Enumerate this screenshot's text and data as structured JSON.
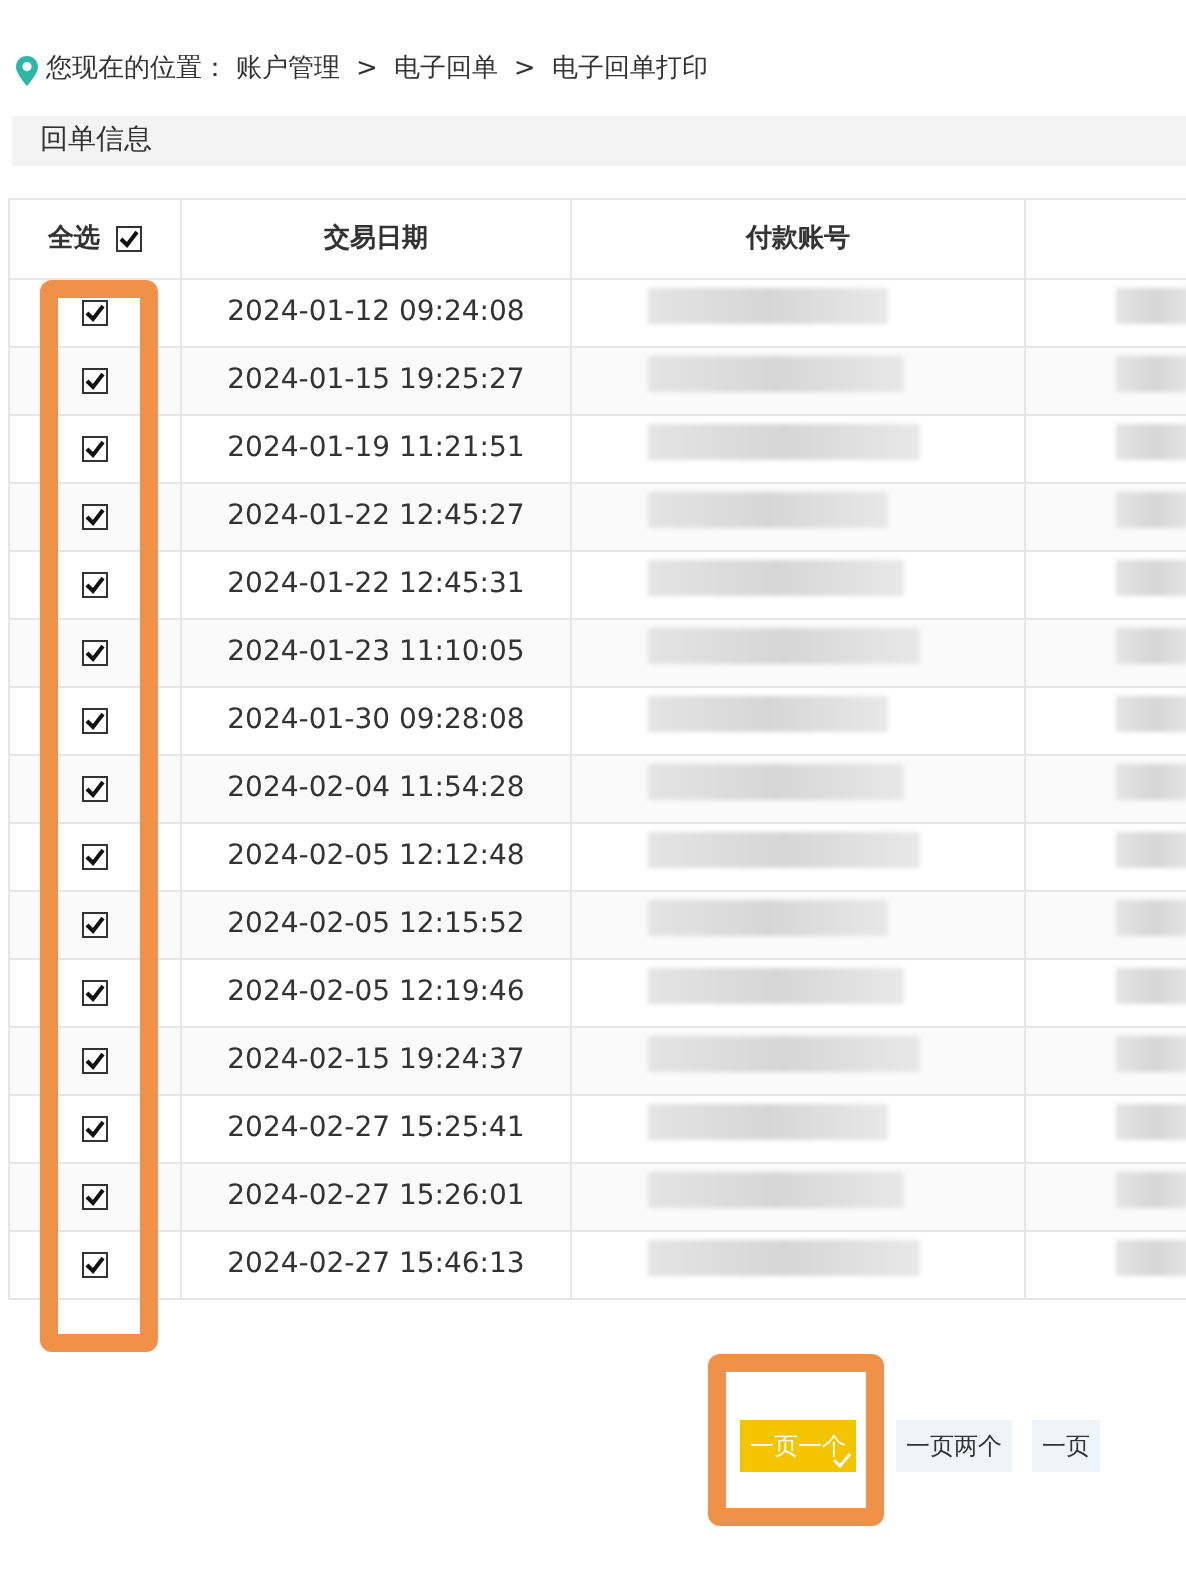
{
  "breadcrumb": {
    "label": "您现在的位置：",
    "path": [
      "账户管理",
      "电子回单",
      "电子回单打印"
    ],
    "separator": ">"
  },
  "section_title": "回单信息",
  "table": {
    "select_all": {
      "label": "全选",
      "checked": true
    },
    "columns": [
      "交易日期",
      "付款账号"
    ],
    "rows": [
      {
        "checked": true,
        "date": "2024-01-12 09:24:08"
      },
      {
        "checked": true,
        "date": "2024-01-15 19:25:27"
      },
      {
        "checked": true,
        "date": "2024-01-19 11:21:51"
      },
      {
        "checked": true,
        "date": "2024-01-22 12:45:27"
      },
      {
        "checked": true,
        "date": "2024-01-22 12:45:31"
      },
      {
        "checked": true,
        "date": "2024-01-23 11:10:05"
      },
      {
        "checked": true,
        "date": "2024-01-30 09:28:08"
      },
      {
        "checked": true,
        "date": "2024-02-04 11:54:28"
      },
      {
        "checked": true,
        "date": "2024-02-05 12:12:48"
      },
      {
        "checked": true,
        "date": "2024-02-05 12:15:52"
      },
      {
        "checked": true,
        "date": "2024-02-05 12:19:46"
      },
      {
        "checked": true,
        "date": "2024-02-15 19:24:37"
      },
      {
        "checked": true,
        "date": "2024-02-27 15:25:41"
      },
      {
        "checked": true,
        "date": "2024-02-27 15:26:01"
      },
      {
        "checked": true,
        "date": "2024-02-27 15:46:13"
      }
    ]
  },
  "layout_options": [
    {
      "label": "一页一个",
      "selected": true
    },
    {
      "label": "一页两个",
      "selected": false
    },
    {
      "label": "一页",
      "selected": false
    }
  ]
}
